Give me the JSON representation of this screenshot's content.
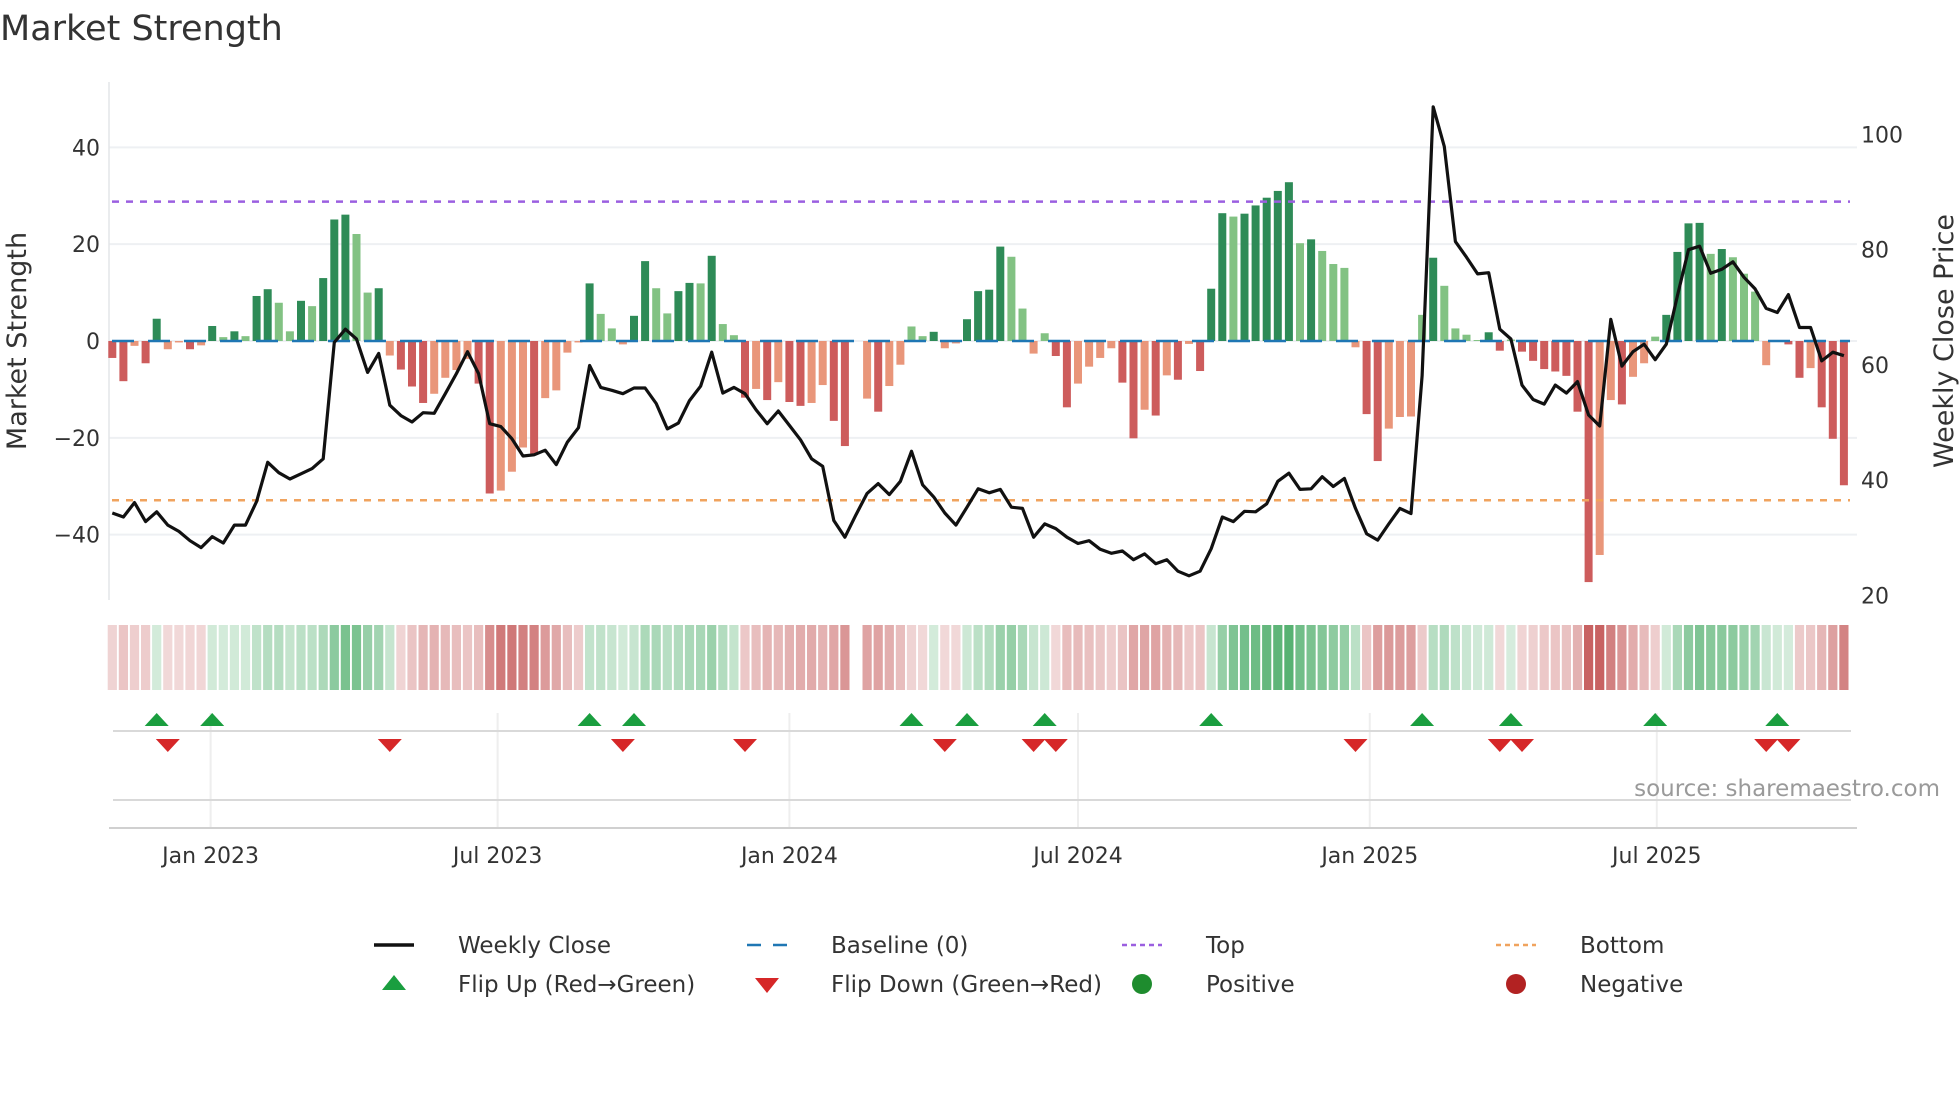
{
  "chart_data": {
    "type": "bar",
    "title": "Market Strength",
    "ylabel": "Market Strength",
    "y2label": "Weekly Close Price",
    "source": "source: sharemaestro.com",
    "frequency": "weekly",
    "start_date": "2022-10-31",
    "ylim": [
      -53.5,
      53.5
    ],
    "y2lim": [
      19.2,
      109.1
    ],
    "yticks": [
      {
        "v": -40,
        "label": "−40"
      },
      {
        "v": -20,
        "label": "−20"
      },
      {
        "v": 0,
        "label": "0"
      },
      {
        "v": 20,
        "label": "20"
      },
      {
        "v": 40,
        "label": "40"
      }
    ],
    "y2ticks": [
      {
        "v": 20,
        "label": "20"
      },
      {
        "v": 40,
        "label": "40"
      },
      {
        "v": 60,
        "label": "60"
      },
      {
        "v": 80,
        "label": "80"
      },
      {
        "v": 100,
        "label": "100"
      }
    ],
    "xticks": [
      {
        "label": "Jan 2023",
        "date": "2023-01-01"
      },
      {
        "label": "Jul 2023",
        "date": "2023-07-01"
      },
      {
        "label": "Jan 2024",
        "date": "2024-01-01"
      },
      {
        "label": "Jul 2024",
        "date": "2024-07-01"
      },
      {
        "label": "Jan 2025",
        "date": "2025-01-01"
      },
      {
        "label": "Jul 2025",
        "date": "2025-07-01"
      }
    ],
    "top_level": 28.8,
    "bottom_level": -32.9,
    "baseline": 0,
    "grid": true,
    "legend_placement": "bottom",
    "strength": [
      -3.5,
      -8.3,
      -1,
      -4.6,
      4.6,
      -1.7,
      -0.3,
      -1.7,
      -0.9,
      3.1,
      0.8,
      2,
      1,
      9.3,
      10.7,
      7.9,
      2,
      8.3,
      7.2,
      13,
      25.1,
      26.1,
      22.1,
      10,
      10.9,
      -3,
      -5.9,
      -9.4,
      -12.8,
      -10.9,
      -7.6,
      -6,
      -3.7,
      -8.8,
      -31.5,
      -30.9,
      -27,
      -22,
      -23.3,
      -11.8,
      -10.2,
      -2.4,
      -0.3,
      11.9,
      5.6,
      2.6,
      -0.7,
      5.2,
      16.5,
      10.9,
      5.7,
      10.3,
      12,
      11.9,
      17.6,
      3.5,
      1.2,
      -11.7,
      -9.9,
      -12.2,
      -8.5,
      -12.6,
      -13.4,
      -12.8,
      -9.1,
      -16.5,
      -21.7,
      null,
      -11.9,
      -14.6,
      -9.3,
      -4.9,
      3,
      1,
      1.9,
      -1.5,
      -0.5,
      4.5,
      10.3,
      10.6,
      19.5,
      17.4,
      6.7,
      -2.6,
      1.6,
      -3.1,
      -13.7,
      -8.8,
      -5.3,
      -3.5,
      -1.5,
      -8.6,
      -20.1,
      -14.2,
      -15.4,
      -7.1,
      -8,
      -0.6,
      -6.2,
      10.8,
      26.4,
      25.7,
      26.3,
      28,
      29.6,
      31,
      32.8,
      20.2,
      21,
      18.6,
      15.9,
      15.1,
      -1.3,
      -15.1,
      -24.8,
      -18.1,
      -15.7,
      -15.6,
      5.4,
      17.2,
      11.4,
      2.6,
      1.3,
      0.2,
      1.8,
      -2,
      0.3,
      -2.2,
      -4.1,
      -5.8,
      -6.3,
      -7.2,
      -14.6,
      -49.8,
      -44.2,
      -12.2,
      -13.1,
      -7.4,
      -4.6,
      0.9,
      5.4,
      18.4,
      24.3,
      24.4,
      18,
      19,
      17.3,
      13.9,
      10.2,
      -5,
      0.2,
      -0.7,
      -7.6,
      -5.6,
      -13.7,
      -20.2,
      -29.8
    ],
    "weekly_close": [
      34.3,
      33.6,
      36.1,
      32.8,
      34.5,
      32.2,
      31.1,
      29.5,
      28.3,
      30.2,
      29.1,
      32.2,
      32.2,
      36.3,
      43.1,
      41.3,
      40.2,
      41.1,
      42.0,
      43.7,
      63.9,
      66.2,
      64.5,
      58.7,
      62.0,
      53.0,
      51.2,
      50.1,
      51.7,
      51.6,
      55.0,
      58.5,
      62.3,
      58.5,
      49.8,
      49.3,
      47.2,
      44.2,
      44.4,
      45.2,
      42.7,
      46.6,
      49.1,
      59.9,
      56.1,
      55.6,
      55.0,
      56.0,
      56.0,
      53.3,
      48.9,
      49.9,
      53.8,
      56.3,
      62.2,
      55.1,
      56.1,
      55.0,
      52.2,
      49.8,
      52.0,
      49.5,
      47.0,
      43.7,
      42.4,
      33.0,
      30.1,
      34.0,
      37.7,
      39.4,
      37.5,
      39.8,
      45.0,
      39.2,
      37.1,
      34.3,
      32.2,
      35.3,
      38.5,
      37.8,
      38.4,
      35.3,
      35.1,
      30.1,
      32.4,
      31.6,
      30.1,
      29.0,
      29.5,
      28.0,
      27.3,
      27.7,
      26.2,
      27.2,
      25.5,
      26.2,
      24.2,
      23.4,
      24.2,
      28.1,
      33.6,
      32.8,
      34.6,
      34.5,
      35.9,
      39.8,
      41.2,
      38.4,
      38.5,
      40.6,
      38.9,
      40.3,
      35.1,
      30.7,
      29.6,
      32.4,
      35.1,
      34.2,
      58.1,
      104.8,
      97.9,
      81.4,
      78.7,
      75.8,
      76.0,
      66.2,
      64.5,
      56.5,
      54.0,
      53.2,
      56.5,
      55.1,
      57.1,
      51.3,
      49.4,
      67.9,
      59.8,
      62.3,
      63.6,
      60.9,
      63.6,
      72.0,
      80.0,
      80.6,
      75.9,
      76.6,
      77.9,
      75.2,
      73.2,
      69.8,
      69.1,
      72.2,
      66.5,
      66.5,
      60.7,
      62.2,
      61.6
    ],
    "flip_up_weeks": [
      5,
      10,
      44,
      48,
      73,
      78,
      85,
      100,
      119,
      127,
      140,
      151
    ],
    "flip_down_weeks": [
      6,
      26,
      47,
      58,
      76,
      84,
      86,
      113,
      126,
      128,
      150,
      152
    ],
    "legend": [
      {
        "key": "close",
        "label": "Weekly Close"
      },
      {
        "key": "baseline",
        "label": "Baseline (0)"
      },
      {
        "key": "top",
        "label": "Top"
      },
      {
        "key": "bottom",
        "label": "Bottom"
      },
      {
        "key": "flip_up",
        "label": "Flip Up (Red→Green)"
      },
      {
        "key": "flip_down",
        "label": "Flip Down (Green→Red)"
      },
      {
        "key": "positive",
        "label": "Positive"
      },
      {
        "key": "negative",
        "label": "Negative"
      }
    ],
    "colors": {
      "pos_rising": "#2e8b57",
      "pos_falling": "#82c283",
      "neg_rising": "#cd5c5c",
      "neg_falling": "#e9967a",
      "close": "#111111",
      "baseline": "#1f77b4",
      "top": "#9b5fe0",
      "bottom": "#f0a35e",
      "flip_up": "#1a9e3f",
      "flip_down": "#d62728",
      "positive": "#1e8c2e",
      "negative": "#b22222"
    }
  }
}
